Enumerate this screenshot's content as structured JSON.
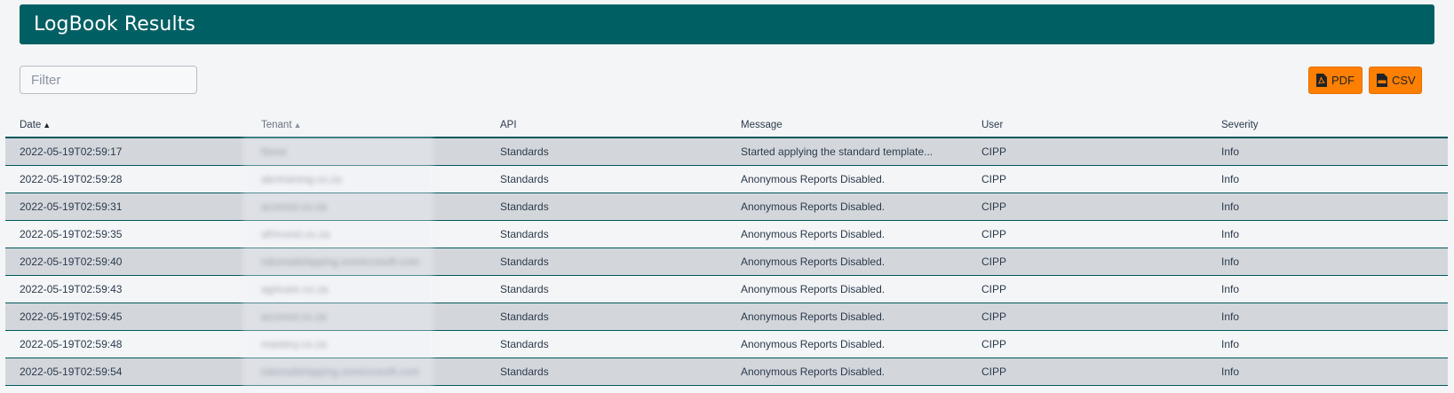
{
  "header": {
    "title": "LogBook Results"
  },
  "filter": {
    "placeholder": "Filter"
  },
  "toolbar": {
    "pdf_label": "PDF",
    "csv_label": "CSV",
    "accent_color": "#ff7f00",
    "header_color": "#005f63"
  },
  "table": {
    "columns": {
      "date": "Date",
      "tenant": "Tenant",
      "api": "API",
      "message": "Message",
      "user": "User",
      "severity": "Severity"
    },
    "sort": {
      "active_column": "Date",
      "direction": "ascending"
    },
    "rows": [
      {
        "date": "2022-05-19T02:59:17",
        "tenant": "None",
        "api": "Standards",
        "message": "Started applying the standard template...",
        "user": "CIPP",
        "severity": "Info"
      },
      {
        "date": "2022-05-19T02:59:28",
        "tenant": "abctraining.co.za",
        "api": "Standards",
        "message": "Anonymous Reports Disabled.",
        "user": "CIPP",
        "severity": "Info"
      },
      {
        "date": "2022-05-19T02:59:31",
        "tenant": "accenol.co.za",
        "api": "Standards",
        "message": "Anonymous Reports Disabled.",
        "user": "CIPP",
        "severity": "Info"
      },
      {
        "date": "2022-05-19T02:59:35",
        "tenant": "afrinvest.co.za",
        "api": "Standards",
        "message": "Anonymous Reports Disabled.",
        "user": "CIPP",
        "severity": "Info"
      },
      {
        "date": "2022-05-19T02:59:40",
        "tenant": "ndomailshipping.onmicrosoft.com",
        "api": "Standards",
        "message": "Anonymous Reports Disabled.",
        "user": "CIPP",
        "severity": "Info"
      },
      {
        "date": "2022-05-19T02:59:43",
        "tenant": "agricare.co.za",
        "api": "Standards",
        "message": "Anonymous Reports Disabled.",
        "user": "CIPP",
        "severity": "Info"
      },
      {
        "date": "2022-05-19T02:59:45",
        "tenant": "accenol.co.za",
        "api": "Standards",
        "message": "Anonymous Reports Disabled.",
        "user": "CIPP",
        "severity": "Info"
      },
      {
        "date": "2022-05-19T02:59:48",
        "tenant": "mastery.co.za",
        "api": "Standards",
        "message": "Anonymous Reports Disabled.",
        "user": "CIPP",
        "severity": "Info"
      },
      {
        "date": "2022-05-19T02:59:54",
        "tenant": "ndomailshipping.onmicrosoft.com",
        "api": "Standards",
        "message": "Anonymous Reports Disabled.",
        "user": "CIPP",
        "severity": "Info"
      }
    ]
  }
}
